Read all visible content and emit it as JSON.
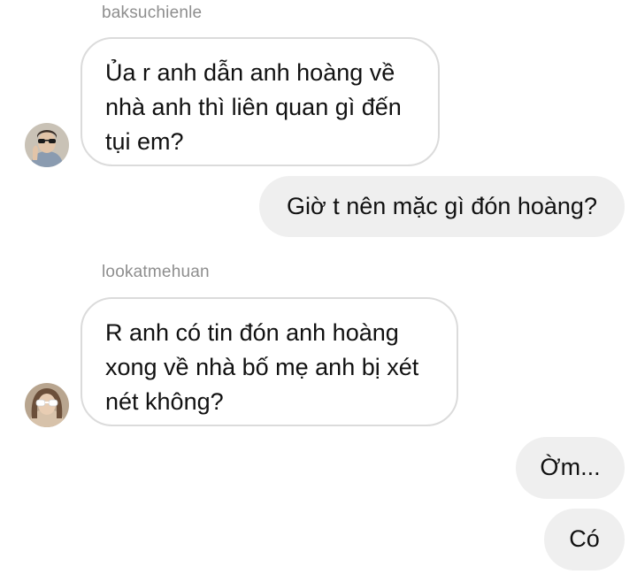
{
  "thread": {
    "messages": [
      {
        "direction": "incoming",
        "sender": "baksuchienle",
        "text": "Ủa r anh dẫn anh hoàng về nhà anh thì liên quan gì đến tụi em?",
        "avatar_icon": "user-avatar-sunglasses-icon"
      },
      {
        "direction": "outgoing",
        "text": "Giờ t nên mặc gì đón hoàng?"
      },
      {
        "direction": "incoming",
        "sender": "lookatmehuan",
        "text": "R anh có tin đón anh hoàng xong về nhà bố mẹ anh bị xét nét không?",
        "avatar_icon": "user-avatar-white-glasses-icon"
      },
      {
        "direction": "outgoing",
        "text": "Ờm..."
      },
      {
        "direction": "outgoing",
        "text": "Có"
      }
    ]
  },
  "colors": {
    "incoming_border": "#dbdbdb",
    "outgoing_background": "#efefef",
    "username": "#8e8e8e",
    "text": "#111111"
  }
}
